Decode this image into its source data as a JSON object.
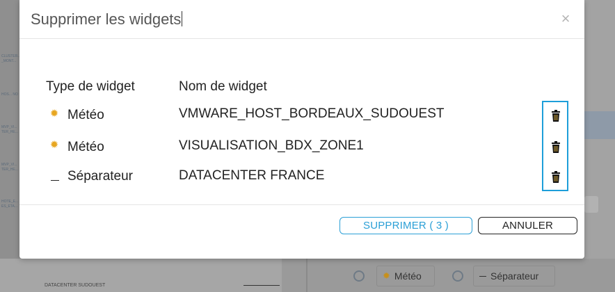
{
  "background": {
    "left_chips": [
      "CLUSTER... _MONT...",
      "HOS... NO",
      "MVP_VI... TER_HE...",
      "MVP_VI... TER_HE...",
      "HOTE_E... ES_ETA..."
    ],
    "footer_text": "DATACENTER SUDOUEST",
    "options": [
      {
        "label": "Météo",
        "icon": "sun-icon"
      },
      {
        "label": "Séparateur",
        "icon": "dash-icon"
      }
    ]
  },
  "dialog": {
    "title": "Supprimer les widgets",
    "close_icon": "close-icon",
    "columns": {
      "type": "Type de widget",
      "name": "Nom de widget"
    },
    "rows": [
      {
        "type": "Météo",
        "icon": "sun-icon",
        "name": "VMWARE_HOST_BORDEAUX_SUDOUEST"
      },
      {
        "type": "Météo",
        "icon": "sun-icon",
        "name": "VISUALISATION_BDX_ZONE1"
      },
      {
        "type": "Séparateur",
        "icon": "dash-icon",
        "name": "DATACENTER FRANCE"
      }
    ],
    "buttons": {
      "delete": "SUPPRIMER ( 3 )",
      "cancel": "ANNULER"
    },
    "colors": {
      "accent": "#1d9ed9",
      "sun": "#e7a620"
    }
  }
}
